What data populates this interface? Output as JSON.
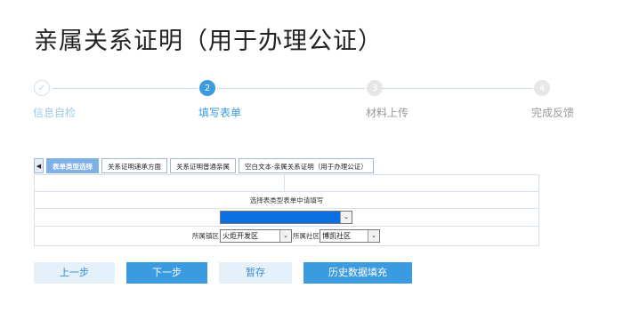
{
  "title": "亲属关系证明（用于办理公证）",
  "steps": [
    {
      "num": "✓",
      "label": "信息自检"
    },
    {
      "num": "2",
      "label": "填写表单"
    },
    {
      "num": "3",
      "label": "材料上传"
    },
    {
      "num": "4",
      "label": "完成反馈"
    }
  ],
  "tabs": {
    "arrow": "◀",
    "items": [
      "表单类型选择",
      "关系证明递承方面",
      "关系证明普通亲属",
      "空白文本-亲属关系证明（用于办理公证）"
    ]
  },
  "form": {
    "instruction": "选择表类型表单中请填写",
    "type_select_value": "",
    "district_label": "所属镇区",
    "district_value": "火炬开发区",
    "community_label": "所属社区",
    "community_value": "博凯社区"
  },
  "buttons": {
    "prev": "上一步",
    "next": "下一步",
    "save": "暂存",
    "history": "历史数据填充"
  }
}
